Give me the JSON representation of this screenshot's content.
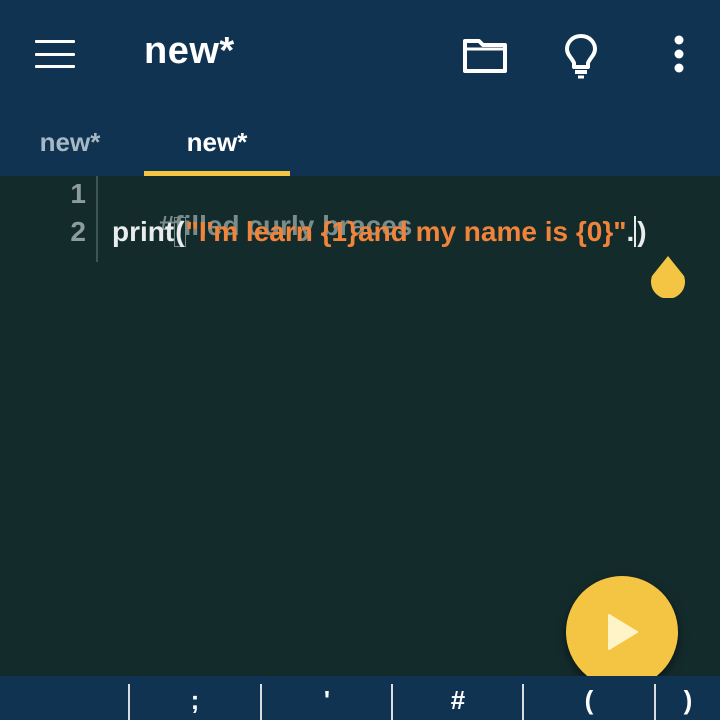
{
  "appbar": {
    "title": "new*"
  },
  "tabs": [
    {
      "label": "new*",
      "active": false
    },
    {
      "label": "new*",
      "active": true
    }
  ],
  "editor": {
    "lines": [
      {
        "number": "1",
        "text": "#filled curly braces"
      },
      {
        "number": "2",
        "func": "print",
        "open_paren": "(",
        "string": "\"I'm learn {1}and my name is {0}\"",
        "dot": ".",
        "close_paren": ")"
      }
    ]
  },
  "symbols": [
    "",
    ";",
    "'",
    "#",
    "(",
    ")"
  ],
  "colors": {
    "appbar": "#0f3350",
    "editor_bg": "#142b2c",
    "accent": "#f4c542",
    "string": "#f0843a",
    "comment": "#7a8d8d"
  },
  "icons": {
    "menu": "hamburger-icon",
    "folder": "folder-icon",
    "hint": "lightbulb-icon",
    "more": "more-vert-icon",
    "run": "play-icon"
  }
}
